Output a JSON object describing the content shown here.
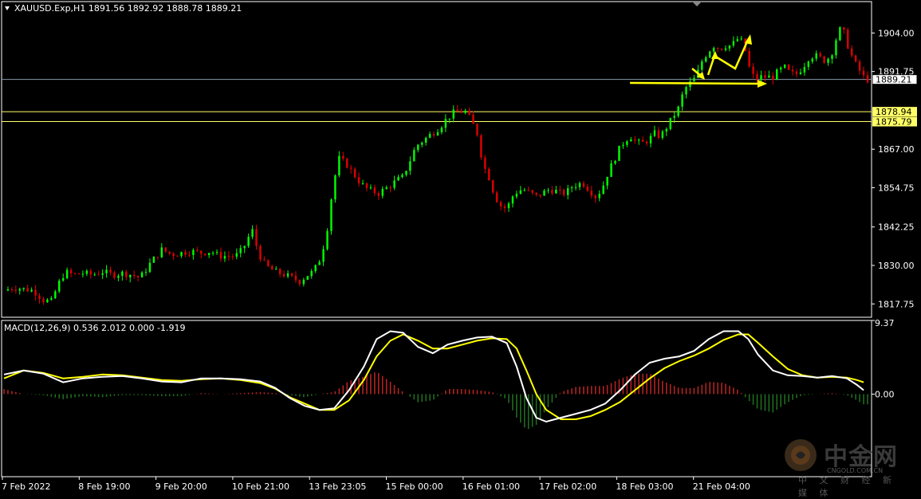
{
  "main_header": "XAUUSD.Exp,H1  1891.56 1892.92 1888.78 1889.21",
  "macd_header": "MACD(12,26,9) 0.536 2.012 0.000 -1.919",
  "colors": {
    "background": "#000000",
    "bull": "#00ff00",
    "bear": "#e00000",
    "macd_line": "#ffffff",
    "signal_line": "#ffff00",
    "hist_pos": "#b22222",
    "hist_neg": "#1f6b1f",
    "level_line": "#ffff66",
    "current_line": "#8899aa",
    "arrow": "#ffff00",
    "axis": "#ffffff"
  },
  "watermark": {
    "logo": "中金网",
    "url": "CNGOLD.COM.CN",
    "sub": "中 文 财 经 新 媒 体"
  },
  "chart_data": [
    {
      "type": "candlestick",
      "symbol": "XAUUSD.Exp",
      "timeframe": "H1",
      "ohlc_last": {
        "open": 1891.56,
        "high": 1892.92,
        "low": 1888.78,
        "close": 1889.21
      },
      "ylim": [
        1813.5,
        1914.0
      ],
      "y_ticks": [
        1904.0,
        1891.75,
        1867.0,
        1854.75,
        1842.25,
        1830.0,
        1817.75
      ],
      "y_tick_labels": [
        "1904.00",
        "1891.75",
        "1867.00",
        "1854.75",
        "1842.25",
        "1830.00",
        "1817.75"
      ],
      "x_tick_labels": [
        "7 Feb 2022",
        "8 Feb 19:00",
        "9 Feb 20:00",
        "10 Feb 21:00",
        "13 Feb 23:05",
        "15 Feb 00:00",
        "16 Feb 01:00",
        "17 Feb 02:00",
        "18 Feb 03:00",
        "21 Feb 04:00"
      ],
      "horizontal_lines": [
        {
          "value": 1878.94,
          "label": "1878.94"
        },
        {
          "value": 1875.79,
          "label": "1875.79"
        }
      ],
      "current_price": {
        "value": 1889.21,
        "label": "1889.21"
      },
      "close_path": [
        [
          0,
          1822
        ],
        [
          10,
          1823
        ],
        [
          20,
          1822.5
        ],
        [
          30,
          1822
        ],
        [
          40,
          1819
        ],
        [
          48,
          1818.5
        ],
        [
          55,
          1824
        ],
        [
          62,
          1828
        ],
        [
          70,
          1827
        ],
        [
          80,
          1827.5
        ],
        [
          90,
          1827
        ],
        [
          100,
          1828
        ],
        [
          110,
          1827
        ],
        [
          120,
          1827.5
        ],
        [
          130,
          1827
        ],
        [
          138,
          1826
        ],
        [
          148,
          1830.5
        ],
        [
          160,
          1835
        ],
        [
          170,
          1833.5
        ],
        [
          180,
          1834
        ],
        [
          190,
          1834.5
        ],
        [
          200,
          1834
        ],
        [
          210,
          1834.5
        ],
        [
          218,
          1833
        ],
        [
          225,
          1833
        ],
        [
          235,
          1833
        ],
        [
          242,
          1835
        ],
        [
          248,
          1839
        ],
        [
          252,
          1841
        ],
        [
          258,
          1834
        ],
        [
          265,
          1830
        ],
        [
          275,
          1828
        ],
        [
          285,
          1827
        ],
        [
          292,
          1826
        ],
        [
          300,
          1825
        ],
        [
          308,
          1827
        ],
        [
          314,
          1828
        ],
        [
          322,
          1833
        ],
        [
          328,
          1842
        ],
        [
          334,
          1856
        ],
        [
          340,
          1864
        ],
        [
          348,
          1862
        ],
        [
          355,
          1859
        ],
        [
          362,
          1856
        ],
        [
          370,
          1854
        ],
        [
          380,
          1853
        ],
        [
          390,
          1855
        ],
        [
          398,
          1857
        ],
        [
          404,
          1858
        ],
        [
          410,
          1862
        ],
        [
          418,
          1868
        ],
        [
          426,
          1870
        ],
        [
          434,
          1872
        ],
        [
          442,
          1874
        ],
        [
          450,
          1877
        ],
        [
          456,
          1878.5
        ],
        [
          462,
          1879
        ],
        [
          468,
          1879
        ],
        [
          474,
          1876
        ],
        [
          480,
          1872
        ],
        [
          486,
          1862
        ],
        [
          492,
          1858
        ],
        [
          498,
          1852
        ],
        [
          504,
          1849
        ],
        [
          510,
          1848
        ],
        [
          516,
          1852
        ],
        [
          522,
          1854
        ],
        [
          528,
          1854
        ],
        [
          534,
          1853
        ],
        [
          540,
          1852
        ],
        [
          546,
          1853
        ],
        [
          552,
          1854
        ],
        [
          558,
          1854
        ],
        [
          564,
          1853
        ],
        [
          570,
          1853
        ],
        [
          576,
          1855
        ],
        [
          582,
          1856
        ],
        [
          588,
          1856
        ],
        [
          594,
          1854
        ],
        [
          600,
          1852
        ],
        [
          606,
          1854
        ],
        [
          612,
          1859
        ],
        [
          618,
          1863
        ],
        [
          624,
          1867
        ],
        [
          630,
          1870
        ],
        [
          636,
          1871
        ],
        [
          642,
          1869
        ],
        [
          648,
          1869
        ],
        [
          654,
          1870
        ],
        [
          660,
          1872
        ],
        [
          666,
          1871
        ],
        [
          672,
          1874
        ],
        [
          678,
          1877
        ],
        [
          684,
          1880
        ],
        [
          690,
          1886
        ],
        [
          696,
          1888
        ],
        [
          702,
          1890
        ],
        [
          708,
          1895
        ],
        [
          714,
          1898
        ],
        [
          720,
          1900
        ],
        [
          726,
          1899
        ],
        [
          732,
          1900
        ],
        [
          738,
          1900
        ],
        [
          744,
          1902
        ],
        [
          750,
          1901
        ],
        [
          756,
          1893
        ],
        [
          762,
          1889
        ],
        [
          768,
          1890
        ],
        [
          774,
          1890
        ],
        [
          780,
          1890
        ],
        [
          786,
          1892
        ],
        [
          792,
          1893
        ],
        [
          798,
          1891
        ],
        [
          804,
          1891
        ],
        [
          810,
          1893
        ],
        [
          816,
          1896
        ],
        [
          822,
          1897
        ],
        [
          828,
          1896
        ],
        [
          834,
          1895
        ],
        [
          840,
          1898
        ],
        [
          846,
          1904
        ],
        [
          850,
          1906
        ],
        [
          856,
          1900
        ],
        [
          862,
          1895
        ],
        [
          868,
          1892
        ],
        [
          872,
          1890
        ],
        [
          876,
          1889.21
        ]
      ]
    },
    {
      "type": "line+bar",
      "indicator": "MACD(12,26,9)",
      "values_header": [
        0.536,
        2.012,
        0.0,
        -1.919
      ],
      "ylim": [
        -10.5,
        9.37
      ],
      "y_ticks": [
        9.37,
        0.0
      ],
      "y_tick_labels": [
        "9.37",
        "0.00"
      ],
      "series": [
        {
          "role": "macd",
          "points": [
            [
              0,
              2.5
            ],
            [
              20,
              3.0
            ],
            [
              40,
              2.6
            ],
            [
              60,
              1.5
            ],
            [
              80,
              2.0
            ],
            [
              100,
              2.2
            ],
            [
              120,
              2.3
            ],
            [
              140,
              2.0
            ],
            [
              160,
              1.6
            ],
            [
              180,
              1.5
            ],
            [
              200,
              2.0
            ],
            [
              220,
              2.0
            ],
            [
              240,
              1.9
            ],
            [
              260,
              1.6
            ],
            [
              275,
              0.8
            ],
            [
              290,
              -0.5
            ],
            [
              305,
              -1.5
            ],
            [
              320,
              -2.0
            ],
            [
              335,
              -1.8
            ],
            [
              350,
              0.5
            ],
            [
              365,
              3.5
            ],
            [
              378,
              7.0
            ],
            [
              392,
              8.0
            ],
            [
              405,
              7.8
            ],
            [
              420,
              6.0
            ],
            [
              435,
              5.2
            ],
            [
              450,
              6.3
            ],
            [
              465,
              6.8
            ],
            [
              480,
              7.2
            ],
            [
              495,
              7.3
            ],
            [
              510,
              6.5
            ],
            [
              520,
              3.5
            ],
            [
              530,
              -0.5
            ],
            [
              540,
              -3.0
            ],
            [
              550,
              -3.5
            ],
            [
              565,
              -3.0
            ],
            [
              580,
              -2.5
            ],
            [
              595,
              -2.0
            ],
            [
              610,
              -1.2
            ],
            [
              625,
              0.5
            ],
            [
              640,
              2.5
            ],
            [
              655,
              4.0
            ],
            [
              670,
              4.5
            ],
            [
              685,
              4.8
            ],
            [
              700,
              5.5
            ],
            [
              715,
              7.0
            ],
            [
              730,
              8.0
            ],
            [
              745,
              8.0
            ],
            [
              755,
              7.0
            ],
            [
              765,
              5.0
            ],
            [
              780,
              3.0
            ],
            [
              795,
              2.4
            ],
            [
              810,
              2.3
            ],
            [
              825,
              2.1
            ],
            [
              840,
              2.3
            ],
            [
              855,
              2.0
            ],
            [
              865,
              1.2
            ],
            [
              872,
              0.5
            ]
          ]
        },
        {
          "role": "signal",
          "points": [
            [
              0,
              2.0
            ],
            [
              20,
              3.0
            ],
            [
              40,
              2.7
            ],
            [
              60,
              2.0
            ],
            [
              80,
              2.2
            ],
            [
              100,
              2.5
            ],
            [
              120,
              2.4
            ],
            [
              140,
              2.1
            ],
            [
              160,
              1.8
            ],
            [
              180,
              1.7
            ],
            [
              200,
              1.9
            ],
            [
              220,
              2.0
            ],
            [
              240,
              1.8
            ],
            [
              260,
              1.4
            ],
            [
              275,
              0.7
            ],
            [
              290,
              -0.4
            ],
            [
              305,
              -1.2
            ],
            [
              320,
              -2.0
            ],
            [
              335,
              -2.0
            ],
            [
              350,
              -0.8
            ],
            [
              365,
              1.8
            ],
            [
              378,
              4.8
            ],
            [
              392,
              6.8
            ],
            [
              405,
              7.6
            ],
            [
              420,
              6.8
            ],
            [
              435,
              5.8
            ],
            [
              450,
              5.8
            ],
            [
              465,
              6.3
            ],
            [
              480,
              6.8
            ],
            [
              495,
              7.1
            ],
            [
              510,
              7.0
            ],
            [
              520,
              5.8
            ],
            [
              530,
              3.0
            ],
            [
              540,
              0.0
            ],
            [
              550,
              -2.0
            ],
            [
              565,
              -3.2
            ],
            [
              580,
              -3.2
            ],
            [
              595,
              -2.8
            ],
            [
              610,
              -2.0
            ],
            [
              625,
              -1.0
            ],
            [
              640,
              0.5
            ],
            [
              655,
              2.0
            ],
            [
              670,
              3.3
            ],
            [
              685,
              4.2
            ],
            [
              700,
              4.9
            ],
            [
              715,
              5.8
            ],
            [
              730,
              6.9
            ],
            [
              745,
              7.6
            ],
            [
              755,
              7.6
            ],
            [
              765,
              6.5
            ],
            [
              780,
              4.8
            ],
            [
              795,
              3.2
            ],
            [
              810,
              2.4
            ],
            [
              825,
              2.1
            ],
            [
              840,
              2.2
            ],
            [
              855,
              2.1
            ],
            [
              865,
              1.8
            ],
            [
              872,
              1.5
            ]
          ]
        }
      ]
    }
  ]
}
